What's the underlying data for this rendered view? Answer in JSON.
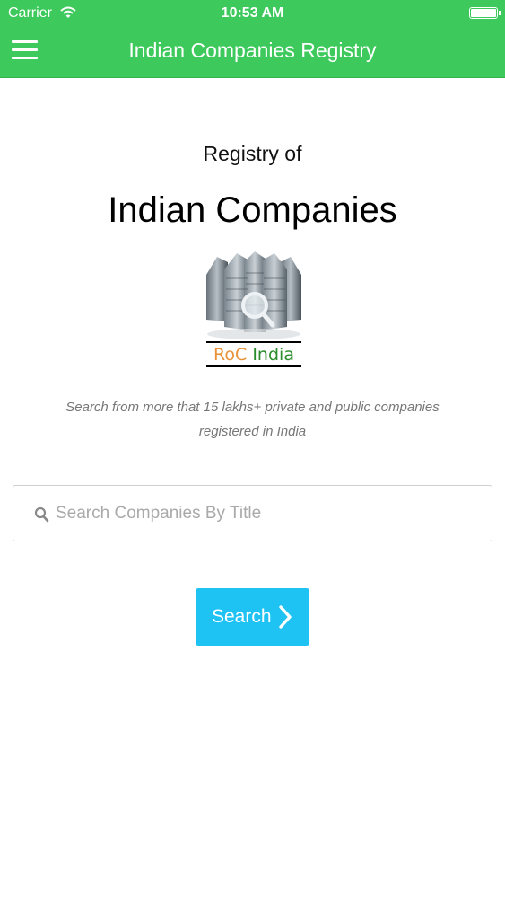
{
  "status_bar": {
    "carrier": "Carrier",
    "time": "10:53 AM"
  },
  "nav": {
    "title": "Indian Companies Registry",
    "menu_icon": "hamburger-menu-icon"
  },
  "hero": {
    "subtitle": "Registry of",
    "headline": "Indian Companies",
    "logo": {
      "text_roc": "RoC",
      "text_india": "India"
    }
  },
  "description": "Search from more that 15 lakhs+ private and public companies registered in India",
  "search": {
    "placeholder": "Search Companies By Title",
    "value": "",
    "icon": "search-icon"
  },
  "search_button": {
    "label": "Search",
    "icon": "chevron-right-icon"
  },
  "colors": {
    "nav_bar": "#3dc95c",
    "button": "#1ec2f3",
    "logo_roc": "#e8923a",
    "logo_india": "#2b8d2b"
  }
}
